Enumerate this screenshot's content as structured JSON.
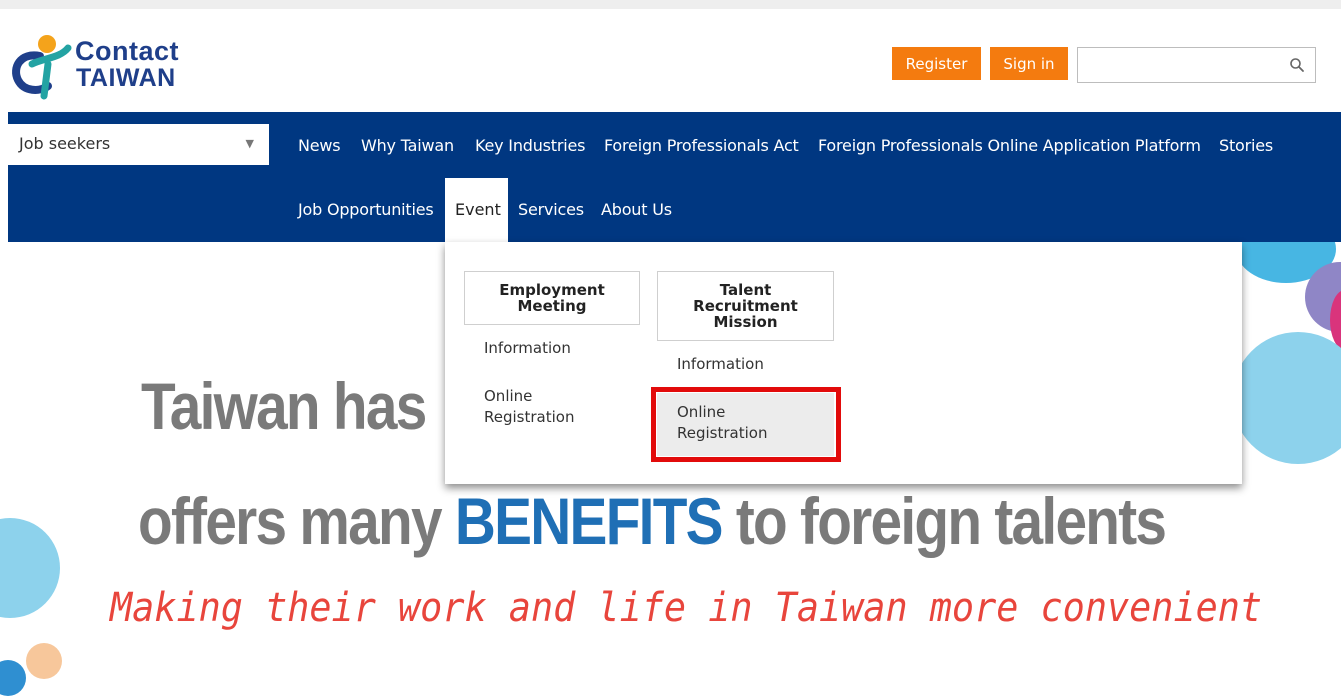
{
  "header": {
    "logo_line1": "Contact",
    "logo_line2": "TAIWAN",
    "register_label": "Register",
    "signin_label": "Sign in",
    "search_placeholder": ""
  },
  "nav": {
    "audience_select": "Job seekers",
    "row1": [
      "News",
      "Why Taiwan",
      "Key Industries",
      "Foreign Professionals Act",
      "Foreign Professionals Online Application Platform",
      "Stories"
    ],
    "row2": [
      "Job Opportunities",
      "Event",
      "Services",
      "About Us"
    ],
    "active": "Event"
  },
  "dropdown": {
    "col1": {
      "heading": "Employment Meeting",
      "links": [
        "Information",
        "Online Registration"
      ]
    },
    "col2": {
      "heading": "Talent Recruitment Mission",
      "links": [
        "Information",
        "Online Registration"
      ]
    }
  },
  "hero": {
    "line1": "Taiwan has",
    "line2_pre": "offers many ",
    "line2_highlight": "BENEFITS",
    "line2_post": " to foreign talents",
    "line3": "Making their work and life in Taiwan more convenient"
  },
  "colors": {
    "brand_blue": "#003781",
    "accent_orange": "#f47b0f",
    "highlight_red": "#e20b0b"
  }
}
